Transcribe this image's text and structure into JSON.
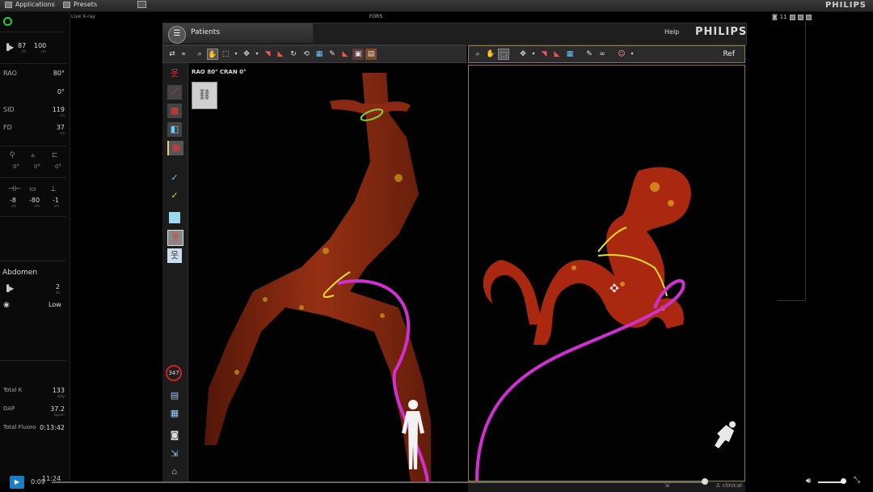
{
  "topbar": {
    "applications": "Applications",
    "presets": "Presets",
    "brand": "PHILIPS"
  },
  "header": {
    "live_xray": "Live X-ray",
    "fors": "FORS",
    "window_count": "11"
  },
  "left_panel": {
    "kv": "87",
    "kv_unit": "kV",
    "ma": "100",
    "ma_unit": "ms",
    "rao_label": "RAO",
    "rao_value": "80°",
    "cran_value": "0°",
    "sid_label": "SID",
    "sid_value": "119",
    "sid_unit": "cm",
    "fd_label": "FD",
    "fd_value": "37",
    "fd_unit": "cm",
    "angles": [
      "0°",
      "0°",
      "0°"
    ],
    "table": [
      "-8",
      "-80",
      "-1"
    ],
    "table_unit": "cm",
    "region": "Abdomen",
    "frame_rate": "2",
    "frame_unit": "f/s",
    "dose_level": "Low",
    "total_k_label": "Total K",
    "total_k_value": "133",
    "total_k_unit": "mGy",
    "dap_label": "DAP",
    "dap_value": "37.2",
    "dap_unit": "Gycm²",
    "total_fluoro_label": "Total Fluoro",
    "total_fluoro_value": "0:13:42"
  },
  "app": {
    "patients": "Patients",
    "help": "Help",
    "brand": "PHILIPS"
  },
  "viewport_left": {
    "label": "RAO 80° CRAN 0°"
  },
  "viewport_right": {
    "ref": "Ref"
  },
  "side_toolbar": {
    "counter": "347"
  },
  "status": {
    "clinical": "clinical"
  },
  "player": {
    "current": "0:09",
    "total": "11:24",
    "progress": 0.99,
    "volume": 0.85
  },
  "colors": {
    "catheter": "#d030d0",
    "guidewire": "#e8e020",
    "vessel": "#a82a10",
    "accent": "#1d7dc4"
  }
}
